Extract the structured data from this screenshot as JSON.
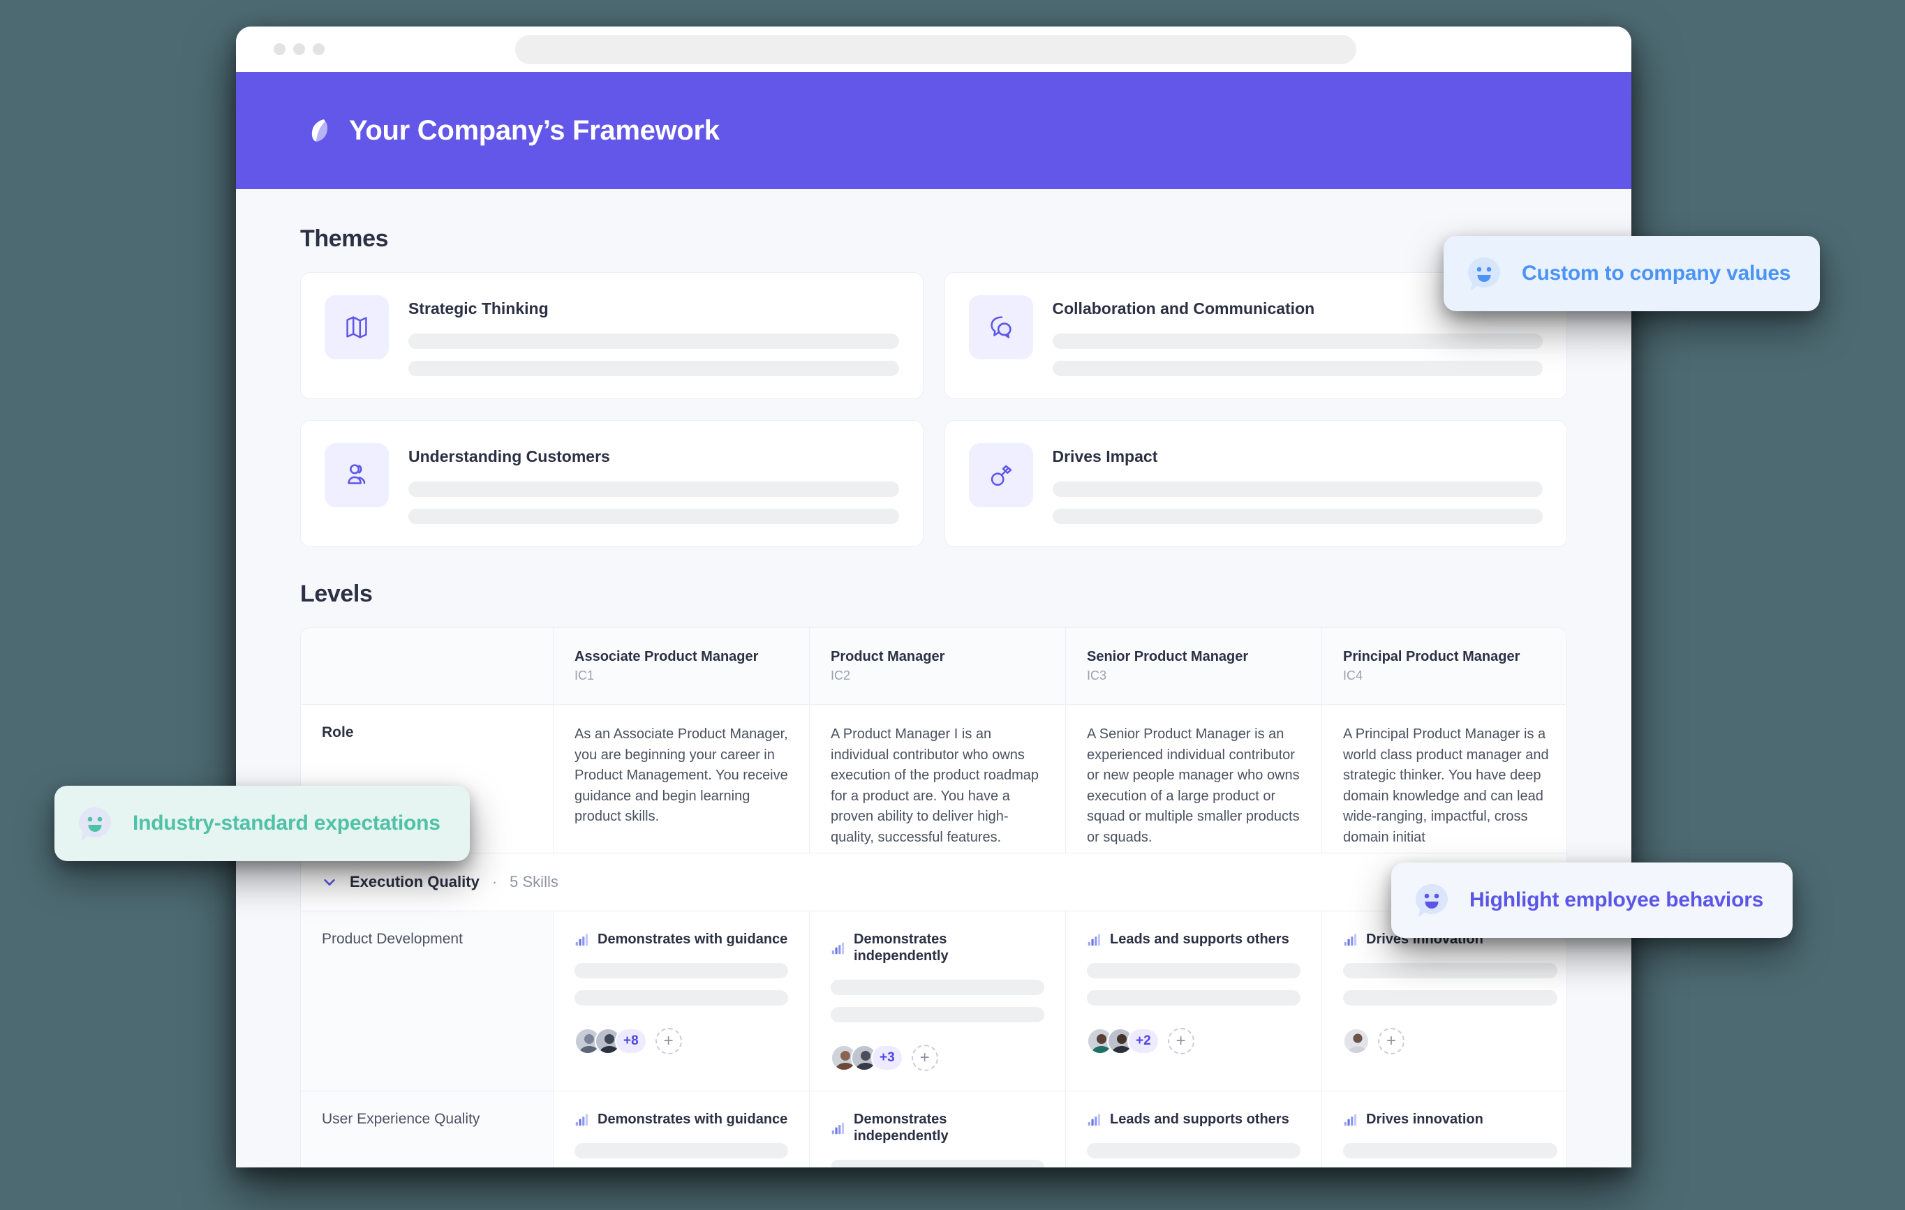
{
  "browser": {
    "url_value": "",
    "url_placeholder": "",
    "traffic_lights": [
      "close",
      "minimize",
      "zoom"
    ]
  },
  "header": {
    "title": "Your Company’s Framework",
    "logo_icon": "leaf-logo-icon",
    "accent_color": "#6257e8"
  },
  "themes": {
    "section_title": "Themes",
    "items": [
      {
        "name": "Strategic Thinking",
        "icon": "map-icon"
      },
      {
        "name": "Collaboration and Communication",
        "icon": "chat-bubbles-icon"
      },
      {
        "name": "Understanding Customers",
        "icon": "users-icon"
      },
      {
        "name": "Drives Impact",
        "icon": "medal-icon"
      }
    ]
  },
  "levels": {
    "section_title": "Levels",
    "row_header_label": "",
    "columns": [
      {
        "name": "Associate Product Manager",
        "code": "IC1"
      },
      {
        "name": "Product Manager",
        "code": "IC2"
      },
      {
        "name": "Senior Product Manager",
        "code": "IC3"
      },
      {
        "name": "Principal Product Manager",
        "code": "IC4"
      }
    ],
    "role_row": {
      "label": "Role",
      "values": [
        "As an Associate Product Manager, you are beginning your career in Product Management. You receive guidance and begin learning product skills.",
        "A Product Manager I is an individual contributor who owns execution of the product roadmap for a product are. You have a proven ability to deliver high-quality, successful features.",
        "A Senior Product Manager is an experienced individual contributor or new people manager who owns execution of a large product or squad or multiple smaller products or squads.",
        "A Principal Product Manager is a world class product manager and strategic thinker.  You have deep domain knowledge and can lead wide-ranging, impactful, cross domain initiat"
      ]
    },
    "group": {
      "name": "Execution Quality",
      "separator": "·",
      "count": "5 Skills",
      "chevron_icon": "chevron-down-icon",
      "expanded": true
    },
    "skills": [
      {
        "name": "Product Development",
        "cells": [
          {
            "level_text": "Demonstrates with guidance",
            "icon": "bar-chart-icon",
            "avatars": 2,
            "more_count": "+8",
            "add_label": "+"
          },
          {
            "level_text": "Demonstrates independently",
            "icon": "bar-chart-icon",
            "avatars": 2,
            "more_count": "+3",
            "add_label": "+"
          },
          {
            "level_text": "Leads and supports others",
            "icon": "bar-chart-icon",
            "avatars": 2,
            "more_count": "+2",
            "add_label": "+"
          },
          {
            "level_text": "Drives innovation",
            "icon": "bar-chart-icon",
            "avatars": 1,
            "more_count": "",
            "add_label": "+"
          }
        ]
      },
      {
        "name": "User Experience Quality",
        "cells": [
          {
            "level_text": "Demonstrates with guidance",
            "icon": "bar-chart-icon",
            "avatars": 0,
            "more_count": "",
            "add_label": ""
          },
          {
            "level_text": "Demonstrates independently",
            "icon": "bar-chart-icon",
            "avatars": 0,
            "more_count": "",
            "add_label": ""
          },
          {
            "level_text": "Leads and supports others",
            "icon": "bar-chart-icon",
            "avatars": 0,
            "more_count": "",
            "add_label": ""
          },
          {
            "level_text": "Drives innovation",
            "icon": "bar-chart-icon",
            "avatars": 0,
            "more_count": "",
            "add_label": ""
          }
        ]
      }
    ]
  },
  "callouts": [
    {
      "id": "values",
      "text": "Custom to company values",
      "icon": "smiley-bubble-icon",
      "color": "#4b94f5",
      "bg": "#eaf2fe"
    },
    {
      "id": "industry",
      "text": "Industry-standard expectations",
      "icon": "smiley-bubble-icon",
      "color": "#4fc1a6",
      "bg": "#e6f4f2"
    },
    {
      "id": "behaviors",
      "text": "Highlight employee behaviors",
      "icon": "smiley-bubble-icon",
      "color": "#5b56e8",
      "bg": "#f4f6fd"
    }
  ]
}
